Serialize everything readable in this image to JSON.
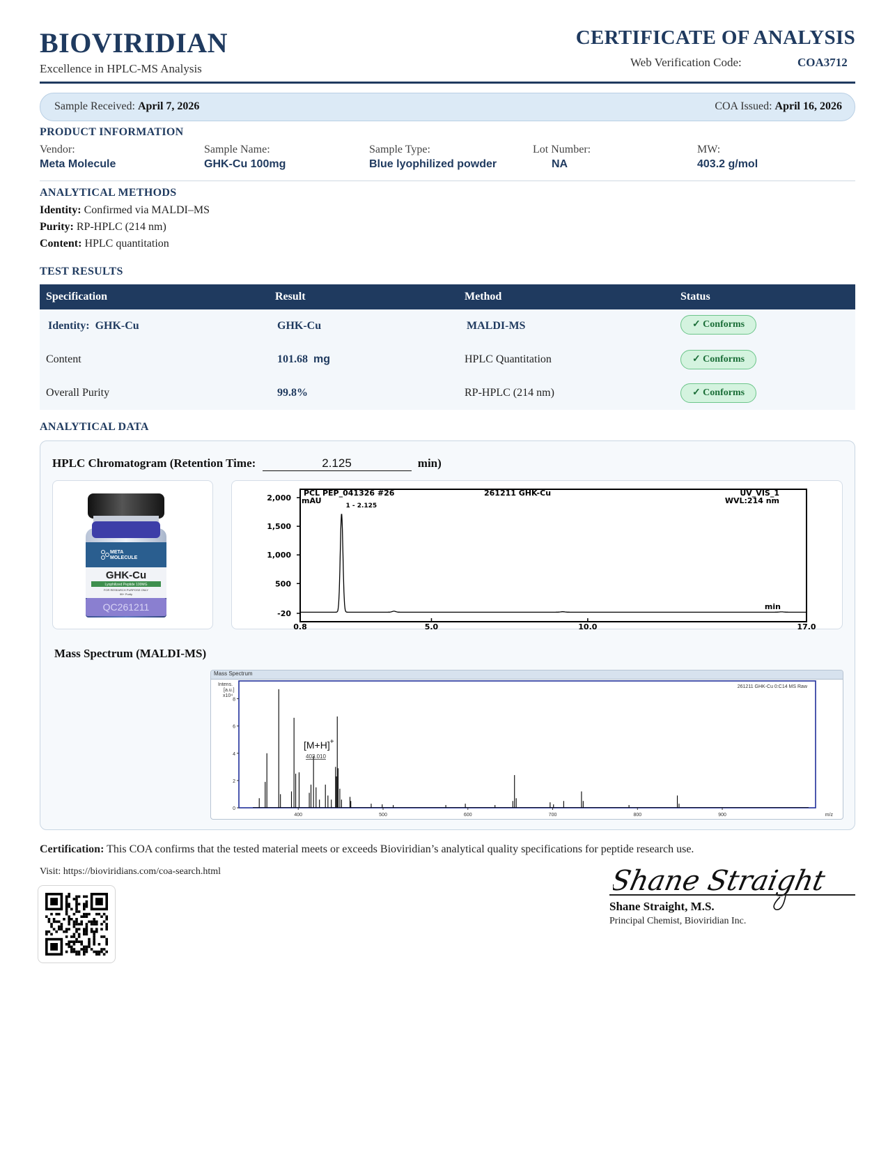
{
  "header": {
    "brand": "BIOVIRIDIAN",
    "tagline": "Excellence in HPLC-MS Analysis",
    "doc_title": "CERTIFICATE OF ANALYSIS",
    "verification_label": "Web Verification Code:",
    "verification_code": "COA3712"
  },
  "dates": {
    "received_label": "Sample Received:",
    "received_value": "April 7, 2026",
    "issued_label": "COA Issued:",
    "issued_value": "April 16, 2026"
  },
  "product_info": {
    "heading": "PRODUCT INFORMATION",
    "fields": [
      {
        "label": "Vendor:",
        "value": "Meta Molecule"
      },
      {
        "label": "Sample Name:",
        "value": "GHK-Cu 100mg"
      },
      {
        "label": "Sample Type:",
        "value": "Blue lyophilized powder"
      },
      {
        "label": "Lot Number:",
        "value": "NA"
      },
      {
        "label": "MW:",
        "value": "403.2 g/mol"
      }
    ]
  },
  "methods": {
    "heading": "ANALYTICAL METHODS",
    "lines": [
      {
        "label": "Identity:",
        "value": "Confirmed via MALDI–MS"
      },
      {
        "label": "Purity:",
        "value": "RP-HPLC (214 nm)"
      },
      {
        "label": "Content:",
        "value": "HPLC quantitation"
      }
    ]
  },
  "results": {
    "heading": "TEST RESULTS",
    "columns": [
      "Specification",
      "Result",
      "Method",
      "Status"
    ],
    "rows": [
      {
        "spec_label": "Identity:",
        "spec_value": "GHK-Cu",
        "result": "GHK-Cu",
        "method": "MALDI-MS",
        "status": "✓ Conforms"
      },
      {
        "spec_label": "Content",
        "spec_value": "",
        "result": "101.68",
        "result_unit": "mg",
        "method": "HPLC Quantitation",
        "status": "✓ Conforms"
      },
      {
        "spec_label": "Overall Purity",
        "spec_value": "",
        "result": "99.8%",
        "method": "RP-HPLC (214 nm)",
        "status": "✓ Conforms"
      }
    ]
  },
  "analytical_data": {
    "heading": "ANALYTICAL DATA",
    "hplc_title_prefix": "HPLC Chromatogram (Retention Time:",
    "retention_time": "2.125",
    "hplc_title_suffix": "min)",
    "vial": {
      "brand_line1": "META",
      "brand_line2": "MOLECULE",
      "product": "GHK-Cu",
      "band": "Lyophilized Peptide  100MG",
      "fine1": "FOR RESEARCH PURPOSE ONLY",
      "fine2": "99+ Purity",
      "lot": "QC261211"
    },
    "hplc_header_left": "PCL PEP_041326 #26",
    "hplc_header_mid": "261211 GHK-Cu",
    "hplc_header_right": "UV_VIS_1",
    "hplc_wvl": "WVL:214 nm",
    "hplc_unit": "mAU",
    "hplc_peak_label": "1 - 2.125",
    "hplc_xunit": "min",
    "ms_title": "Mass Spectrum (MALDI-MS)",
    "ms_window_title": "Mass Spectrum",
    "ms_file": "261211 GHK-Cu 0:C14 MS Raw",
    "ms_ylabel1": "Intens.",
    "ms_ylabel2": "[a.u.]",
    "ms_ylabel3": "x10⁴",
    "ms_ion": "[M+H]",
    "ms_ion_sup": "+",
    "ms_ion_mz": "403.010",
    "ms_xunit": "m/z"
  },
  "chart_data": [
    {
      "type": "line",
      "title": "HPLC Chromatogram",
      "xlabel": "min",
      "ylabel": "mAU",
      "xlim": [
        0.8,
        17.0
      ],
      "ylim": [
        -20,
        2000
      ],
      "x_ticks": [
        "0.8",
        "5.0",
        "10.0",
        "17.0"
      ],
      "y_ticks": [
        "-20",
        "500",
        "1,000",
        "1,500",
        "2,000"
      ],
      "grid": false,
      "peaks": [
        {
          "x": 2.125,
          "y": 1720,
          "label": "1 - 2.125"
        },
        {
          "x": 3.8,
          "y": 18
        },
        {
          "x": 9.2,
          "y": 8
        },
        {
          "x": 16.2,
          "y": 6
        }
      ]
    },
    {
      "type": "line",
      "title": "Mass Spectrum (MALDI-MS)",
      "xlabel": "m/z",
      "ylabel": "Intens. [a.u.] x10⁴",
      "xlim": [
        330,
        1010
      ],
      "ylim": [
        0,
        9
      ],
      "x_ticks": [
        "400",
        "500",
        "600",
        "700",
        "800",
        "900"
      ],
      "y_ticks": [
        "0",
        "2",
        "4",
        "6",
        "8"
      ],
      "grid": false,
      "peaks": [
        {
          "x": 354,
          "y": 0.7
        },
        {
          "x": 361,
          "y": 1.9
        },
        {
          "x": 363,
          "y": 4.0
        },
        {
          "x": 377,
          "y": 8.7
        },
        {
          "x": 379,
          "y": 1.0
        },
        {
          "x": 392,
          "y": 1.2
        },
        {
          "x": 395,
          "y": 6.6
        },
        {
          "x": 397,
          "y": 2.5
        },
        {
          "x": 401,
          "y": 2.6
        },
        {
          "x": 413,
          "y": 1.1
        },
        {
          "x": 415,
          "y": 1.7
        },
        {
          "x": 418,
          "y": 3.8
        },
        {
          "x": 421,
          "y": 1.5
        },
        {
          "x": 425,
          "y": 0.6
        },
        {
          "x": 432,
          "y": 1.7
        },
        {
          "x": 435,
          "y": 0.9
        },
        {
          "x": 439,
          "y": 0.6
        },
        {
          "x": 444,
          "y": 3.0
        },
        {
          "x": 445,
          "y": 2.3
        },
        {
          "x": 446,
          "y": 6.7
        },
        {
          "x": 447,
          "y": 2.9
        },
        {
          "x": 449,
          "y": 1.4
        },
        {
          "x": 451,
          "y": 0.6
        },
        {
          "x": 461,
          "y": 0.8
        },
        {
          "x": 462,
          "y": 0.5
        },
        {
          "x": 486,
          "y": 0.3
        },
        {
          "x": 499,
          "y": 0.25
        },
        {
          "x": 512,
          "y": 0.2
        },
        {
          "x": 574,
          "y": 0.2
        },
        {
          "x": 597,
          "y": 0.3
        },
        {
          "x": 632,
          "y": 0.2
        },
        {
          "x": 653,
          "y": 0.5
        },
        {
          "x": 655,
          "y": 2.4
        },
        {
          "x": 657,
          "y": 0.7
        },
        {
          "x": 697,
          "y": 0.4
        },
        {
          "x": 701,
          "y": 0.25
        },
        {
          "x": 713,
          "y": 0.5
        },
        {
          "x": 734,
          "y": 1.2
        },
        {
          "x": 736,
          "y": 0.5
        },
        {
          "x": 790,
          "y": 0.2
        },
        {
          "x": 847,
          "y": 0.9
        },
        {
          "x": 849,
          "y": 0.3
        }
      ]
    }
  ],
  "certification": {
    "label": "Certification:",
    "text": "This COA confirms that the tested material meets or exceeds Bioviridian’s analytical quality specifications for peptide research use.",
    "visit": "Visit: https://bioviridians.com/coa-search.html"
  },
  "signatory": {
    "signature": "Shane Straight",
    "name": "Shane Straight, M.S.",
    "title": "Principal Chemist, Bioviridian Inc."
  },
  "colors": {
    "navy": "#1f3a5f",
    "bar_bg": "#dceaf6",
    "badge_bg": "#d4f3df",
    "badge_text": "#1b6e38"
  }
}
